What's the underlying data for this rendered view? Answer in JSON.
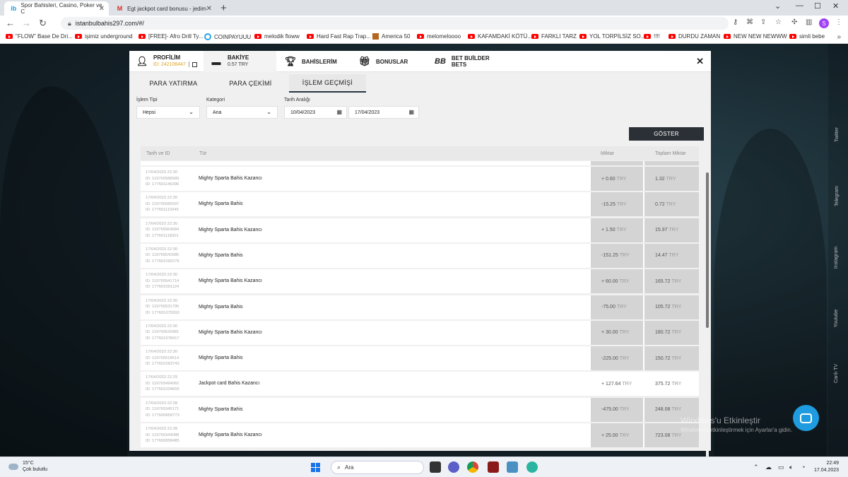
{
  "browser": {
    "tabs": [
      {
        "title": "Spor Bahisleri, Casino, Poker ve C",
        "active": true
      },
      {
        "title": "Egt jackpot card bonusu - jedim",
        "active": false
      }
    ],
    "url": "istanbulbahis297.com/#/",
    "profile_initial": "S",
    "bookmarks": [
      {
        "label": "\"FLOW\" Base De Dri...",
        "icon": "youtube-icon"
      },
      {
        "label": "işimiz underground",
        "icon": "youtube-icon"
      },
      {
        "label": "[FREE]- Afro Drill Ty...",
        "icon": "youtube-icon"
      },
      {
        "label": "COINPAYUUU",
        "icon": "coinpayments-icon"
      },
      {
        "label": "melodik floww",
        "icon": "youtube-icon"
      },
      {
        "label": "Hard Fast Rap Trap...",
        "icon": "youtube-icon"
      },
      {
        "label": "America 50",
        "icon": "image-icon"
      },
      {
        "label": "melomeloooo",
        "icon": "youtube-icon"
      },
      {
        "label": "KAFAMDAKİ KÖTÜ...",
        "icon": "youtube-icon"
      },
      {
        "label": "FARKLI TARZ",
        "icon": "youtube-icon"
      },
      {
        "label": "YOL TORPİLSİZ SO...",
        "icon": "youtube-icon"
      },
      {
        "label": "!!!!",
        "icon": "youtube-icon"
      },
      {
        "label": "DURDU ZAMAN",
        "icon": "youtube-icon"
      },
      {
        "label": "NEW NEW NEWWW",
        "icon": "youtube-icon"
      },
      {
        "label": "simli bebe",
        "icon": "youtube-icon"
      }
    ]
  },
  "modal": {
    "tabs": {
      "profile": {
        "label": "PROFİLİM",
        "id": "ID: 242106447"
      },
      "balance": {
        "label": "BAKİYE",
        "value": "0.57 TRY"
      },
      "bets": {
        "label": "BAHİSLERİM"
      },
      "bonuses": {
        "label": "BONUSLAR"
      },
      "builder": {
        "label": "BET BUİLDER BETS"
      }
    },
    "subtabs": [
      "PARA YATIRMA",
      "PARA ÇEKİMİ",
      "İŞLEM GEÇMİŞİ"
    ],
    "filters": {
      "type_label": "İşlem Tipi",
      "type_value": "Hepsi",
      "category_label": "Kategori",
      "category_value": "Ana",
      "range_label": "Tarih Aralığı",
      "date_from": "10/04/2023",
      "date_to": "17/04/2023"
    },
    "show_button": "GÖSTER",
    "table": {
      "headers": {
        "date": "Tarih ve ID",
        "type": "Tür",
        "amount": "Miktar",
        "total": "Toplam Miktar"
      },
      "rows": [
        {
          "date": "17/04/2023 22:30",
          "id1": "ID: 119765588589",
          "id2": "ID: 177601146396",
          "type": "Mighty Sparta Bahis Kazancı",
          "amount": "+ 0.60",
          "total": "1.32",
          "white": false
        },
        {
          "date": "17/04/2023 22:30",
          "id1": "ID: 119765585597",
          "id2": "ID: 177601119345",
          "type": "Mighty Sparta Bahis",
          "amount": "-15.25",
          "total": "0.72",
          "white": false
        },
        {
          "date": "17/04/2023 22:30",
          "id1": "ID: 119765564684",
          "id2": "ID: 177601118301",
          "type": "Mighty Sparta Bahis Kazancı",
          "amount": "+ 1.50",
          "total": "15.97",
          "white": false
        },
        {
          "date": "17/04/2023 22:30",
          "id1": "ID: 119765542685",
          "id2": "ID: 177601092276",
          "type": "Mighty Sparta Bahis",
          "amount": "-151.25",
          "total": "14.47",
          "white": false
        },
        {
          "date": "17/04/2023 22:30",
          "id1": "ID: 119765541714",
          "id2": "ID: 177601091124",
          "type": "Mighty Sparta Bahis Kazancı",
          "amount": "+ 60.00",
          "total": "165.72",
          "white": false
        },
        {
          "date": "17/04/2023 22:30",
          "id1": "ID: 119765531795",
          "id2": "ID: 177601079393",
          "type": "Mighty Sparta Bahis",
          "amount": "-75.00",
          "total": "105.72",
          "white": false
        },
        {
          "date": "17/04/2023 22:30",
          "id1": "ID: 119765530981",
          "id2": "ID: 177601078417",
          "type": "Mighty Sparta Bahis Kazancı",
          "amount": "+ 30.00",
          "total": "180.72",
          "white": false
        },
        {
          "date": "17/04/2023 22:30",
          "id1": "ID: 119765518614",
          "id2": "ID: 177601063743",
          "type": "Mighty Sparta Bahis",
          "amount": "-225.00",
          "total": "150.72",
          "white": false
        },
        {
          "date": "17/04/2023 22:29",
          "id1": "ID: 119765494062",
          "id2": "ID: 177601034655",
          "type": "Jackpot card Bahis Kazancı",
          "amount": "+ 127.64",
          "total": "375.72",
          "white": true
        },
        {
          "date": "17/04/2023 22:28",
          "id1": "ID: 119765345171",
          "id2": "ID: 177600859773",
          "type": "Mighty Sparta Bahis",
          "amount": "-475.00",
          "total": "248.08",
          "white": false
        },
        {
          "date": "17/04/2023 22:28",
          "id1": "ID: 119765344088",
          "id2": "ID: 177600858485",
          "type": "Mighty Sparta Bahis Kazancı",
          "amount": "+ 25.00",
          "total": "723.08",
          "white": false
        }
      ],
      "currency": "TRY"
    }
  },
  "side_links": [
    "Twitter",
    "Telegram",
    "Instagram",
    "Youtube",
    "Canlı TV"
  ],
  "watermark": {
    "line1": "Windows'u Etkinleştir",
    "line2": "Windows'u etkinleştirmek için Ayarlar'a gidin."
  },
  "taskbar": {
    "weather_temp": "15°C",
    "weather_desc": "Çok bulutlu",
    "search_placeholder": "Ara",
    "time": "22:49",
    "date": "17.04.2023"
  },
  "colors": {
    "accent": "#e0a21c",
    "button": "#2b3036",
    "chat": "#1f9be0"
  }
}
